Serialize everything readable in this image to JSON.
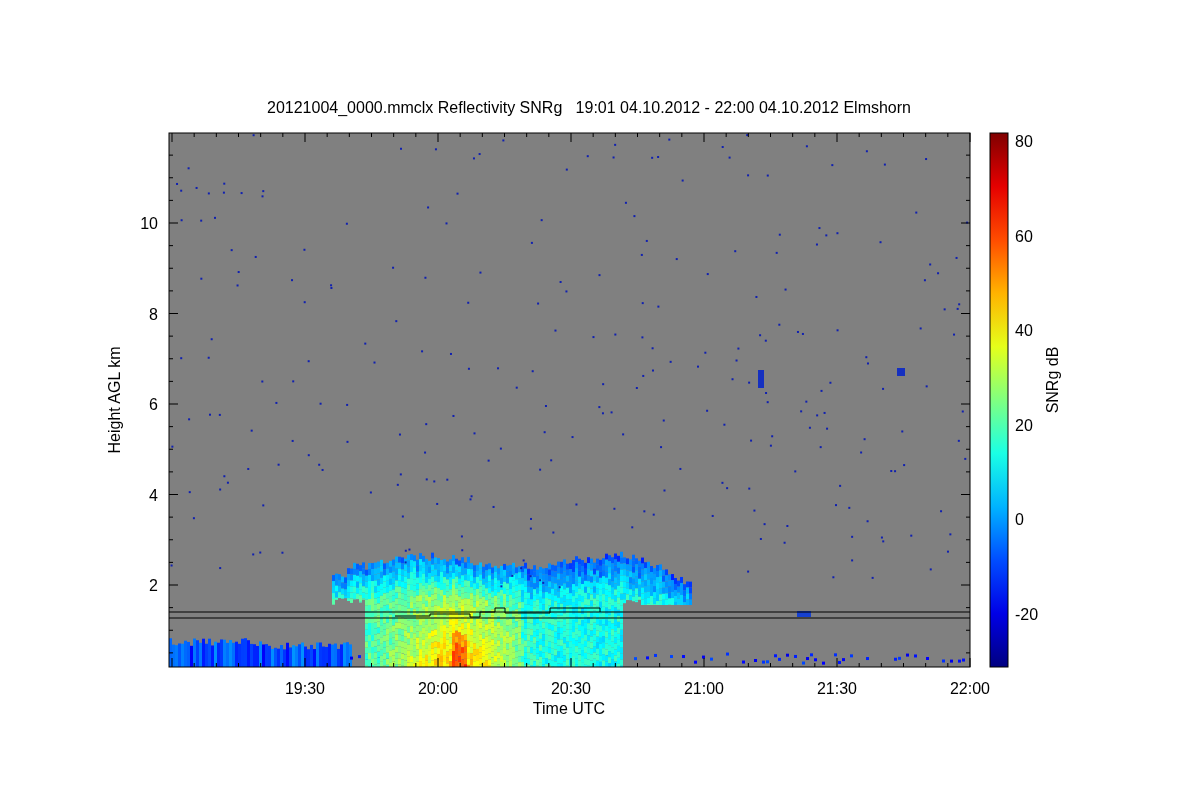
{
  "plot": {
    "title": "20121004_0000.mmclx Reflectivity SNRg   19:01 04.10.2012 - 22:00 04.10.2012 Elmshorn",
    "ylabel": "Height AGL km",
    "xlabel": "Time UTC",
    "yticks": [
      "10",
      "8",
      "6",
      "4",
      "2"
    ],
    "xticks": [
      "19:30",
      "20:00",
      "20:30",
      "21:00",
      "21:30",
      "22:00"
    ]
  },
  "colorbar": {
    "label": "SNRg dB",
    "ticks": [
      "80",
      "60",
      "40",
      "20",
      "0",
      "-20"
    ]
  }
}
